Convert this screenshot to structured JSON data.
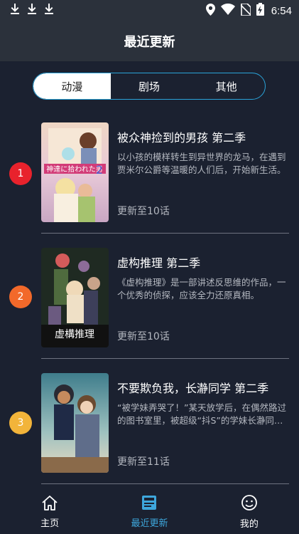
{
  "status_bar": {
    "time": "6:54",
    "left_icons": [
      "download-icon",
      "download-icon",
      "download-icon"
    ],
    "right_icons": [
      "location-icon",
      "wifi-icon",
      "no-sim-icon",
      "battery-charging-icon"
    ]
  },
  "header": {
    "title": "最近更新"
  },
  "tabs": [
    {
      "label": "动漫",
      "active": true
    },
    {
      "label": "剧场",
      "active": false
    },
    {
      "label": "其他",
      "active": false
    }
  ],
  "items": [
    {
      "rank": "1",
      "rank_color": "#e8222c",
      "title": "被众神捡到的男孩 第二季",
      "description": "以小孩的模样转生到异世界的龙马，在遇到贾米尔公爵等温暖的人们后，开始新生活。",
      "update": "更新至10话"
    },
    {
      "rank": "2",
      "rank_color": "#f2692a",
      "title": "虚构推理 第二季",
      "description": "《虚构推理》是一部讲述反思维的作品，一个优秀的侦探，应该全力还原真相。",
      "update": "更新至10话"
    },
    {
      "rank": "3",
      "rank_color": "#f2b43a",
      "title": "不要欺负我，长瀞同学 第二季",
      "description": "“被学妹弄哭了！”某天放学后，在偶然路过的图书室里，被超级“抖S”的学妹长瀞同学盯上了。",
      "update": "更新至11话"
    }
  ],
  "bottom_nav": [
    {
      "label": "主页",
      "icon": "home-icon",
      "active": false
    },
    {
      "label": "最近更新",
      "icon": "news-icon",
      "active": true
    },
    {
      "label": "我的",
      "icon": "profile-icon",
      "active": false
    }
  ],
  "colors": {
    "background": "#1b2130",
    "header": "#2b313b",
    "accent": "#3ea7dc",
    "tab_border": "#2aa3d9"
  }
}
